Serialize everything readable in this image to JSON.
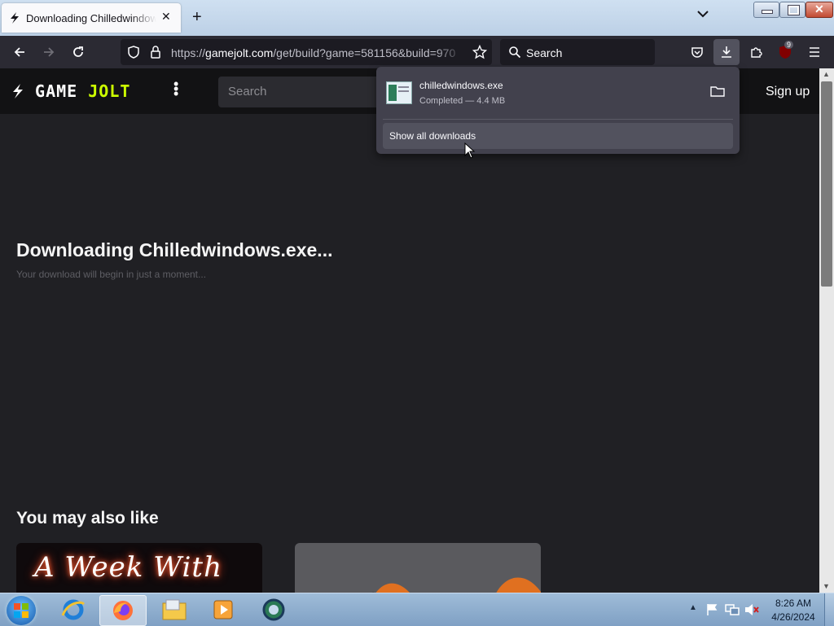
{
  "browser": {
    "tab": {
      "title": "Downloading Chilledwindows.exe..."
    },
    "url": {
      "host": "gamejolt.com",
      "rest": "/get/build?game=581156&build=970",
      "scheme": "https://"
    },
    "search_placeholder": "Search",
    "extension_badge": "9"
  },
  "site": {
    "logo_left": "GAME",
    "logo_right": "JOLT",
    "search_placeholder": "Search",
    "signin_fragment": "n",
    "signup_label": "Sign up"
  },
  "main": {
    "heading": "Downloading Chilledwindows.exe...",
    "subtext": "Your download will begin in just a moment...",
    "also_like_title": "You may also like",
    "cards": [
      {
        "title": "A Week With"
      },
      {
        "title": ""
      }
    ]
  },
  "downloads_panel": {
    "file_name": "chilledwindows.exe",
    "status": "Completed — 4.4 MB",
    "show_all_label": "Show all downloads"
  },
  "taskbar": {
    "time": "8:26 AM",
    "date": "4/26/2024"
  },
  "colors": {
    "accent_lime": "#ccff00",
    "page_bg": "#202024",
    "toolbar_bg": "#2b2a33"
  }
}
